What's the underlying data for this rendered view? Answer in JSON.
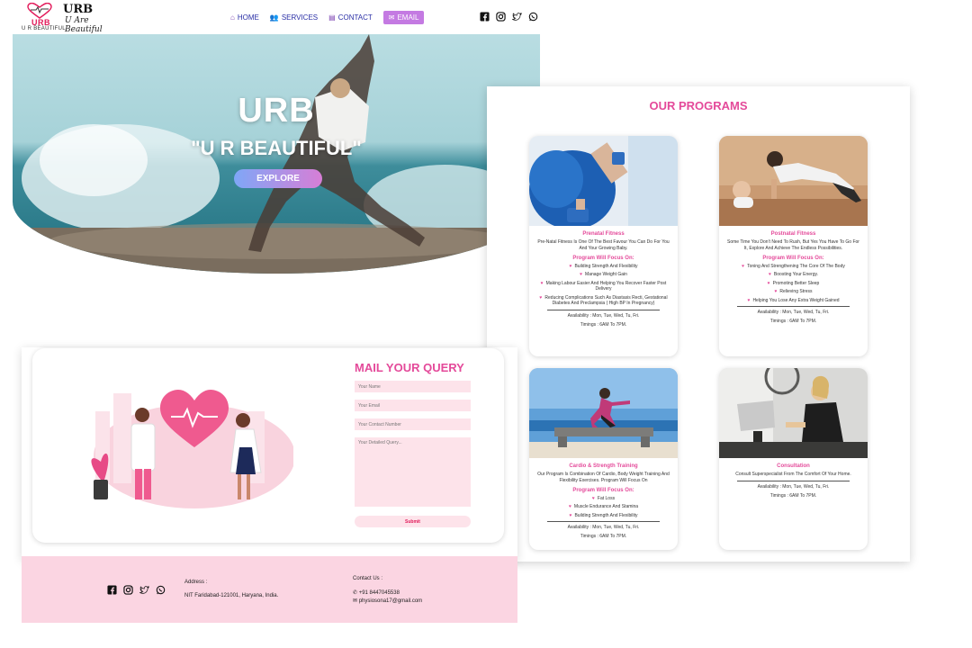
{
  "header": {
    "logo_mark": "URB",
    "logo_sub": "U R BEAUTIFUL",
    "brand_title": "URB",
    "brand_script": "U Are Beautiful",
    "nav": [
      {
        "label": "HOME",
        "icon": "home-icon"
      },
      {
        "label": "SERVICES",
        "icon": "users-icon"
      },
      {
        "label": "CONTACT",
        "icon": "contact-icon"
      },
      {
        "label": "EMAIL",
        "icon": "mail-icon"
      }
    ],
    "social": [
      "facebook-icon",
      "instagram-icon",
      "twitter-icon",
      "whatsapp-icon"
    ]
  },
  "hero": {
    "title": "URB",
    "subtitle": "\"U R BEAUTIFUL\"",
    "cta": "EXPLORE"
  },
  "programs": {
    "title": "OUR PROGRAMS",
    "cards": [
      {
        "title": "Prenatal Fitness",
        "desc": "Pre-Natal Fitness Is One Of The Best Favour You Can Do For You And Your Growing Baby.",
        "focus_label": "Program Will Focus On:",
        "items": [
          "Building Strength And Flexibility",
          "Manage Weight Gain",
          "Making Labour Easier And Helping You Recover Faster Post Delivery",
          "Reducing Complications Such As Diastasis Recti, Gestational Diabetes And Preclampsia ( High BP In Pregnancy)"
        ],
        "availability": "Availability : Mon, Tue, Wed, Tu, Fri.",
        "timings": "Timings : 6AM To 7PM."
      },
      {
        "title": "Postnatal Fitness",
        "desc": "Some Time You Don't Need To Rush, But Yes You Have To Go For It, Explore And Achieve The Endless Possibilities.",
        "focus_label": "Program Will Focus On:",
        "items": [
          "Toning And Strengthening The Core Of The Body",
          "Boosting Your Energy.",
          "Promoting Better Sleep",
          "Relieving Stress",
          "Helping You Lose Any Extra Weight Gained"
        ],
        "availability": "Availability : Mon, Tue, Wed, Tu, Fri.",
        "timings": "Timings : 6AM To 7PM."
      },
      {
        "title": "Cardio & Strength Training",
        "desc": "Our Program Is Combination Of Cardio, Body Weight Training And Flexibility Exercises. Program Will Focus On",
        "focus_label": "Program Will Focus On:",
        "items": [
          "Fat Loss",
          "Muscle Endurance And Stamina",
          "Building Strength And Flexibility"
        ],
        "availability": "Availability : Mon, Tue, Wed, Tu, Fri.",
        "timings": "Timings : 6AM To 7PM."
      },
      {
        "title": "Consultation",
        "desc": "Consult Superspecialist From The Comfort Of Your Home.",
        "availability": "Availability : Mon, Tue, Wed, Tu, Fri.",
        "timings": "Timings : 6AM To 7PM."
      }
    ]
  },
  "query": {
    "title": "MAIL YOUR QUERY",
    "name_placeholder": "Your Name",
    "email_placeholder": "Your Email",
    "phone_placeholder": "Your Contact Number",
    "query_placeholder": "Your Detailed Query...",
    "submit": "Submit"
  },
  "footer": {
    "address_heading": "Address :",
    "address": "NIT Faridabad-121001, Haryana, India.",
    "contact_heading": "Contact Us :",
    "phone": "+91 8447045538",
    "email": "physiosona17@gmail.com"
  },
  "colors": {
    "accent": "#e44a9a",
    "footer_bg": "#fbd5e2",
    "field_bg": "#fde3ea",
    "nav_text": "#2a2fa6"
  }
}
